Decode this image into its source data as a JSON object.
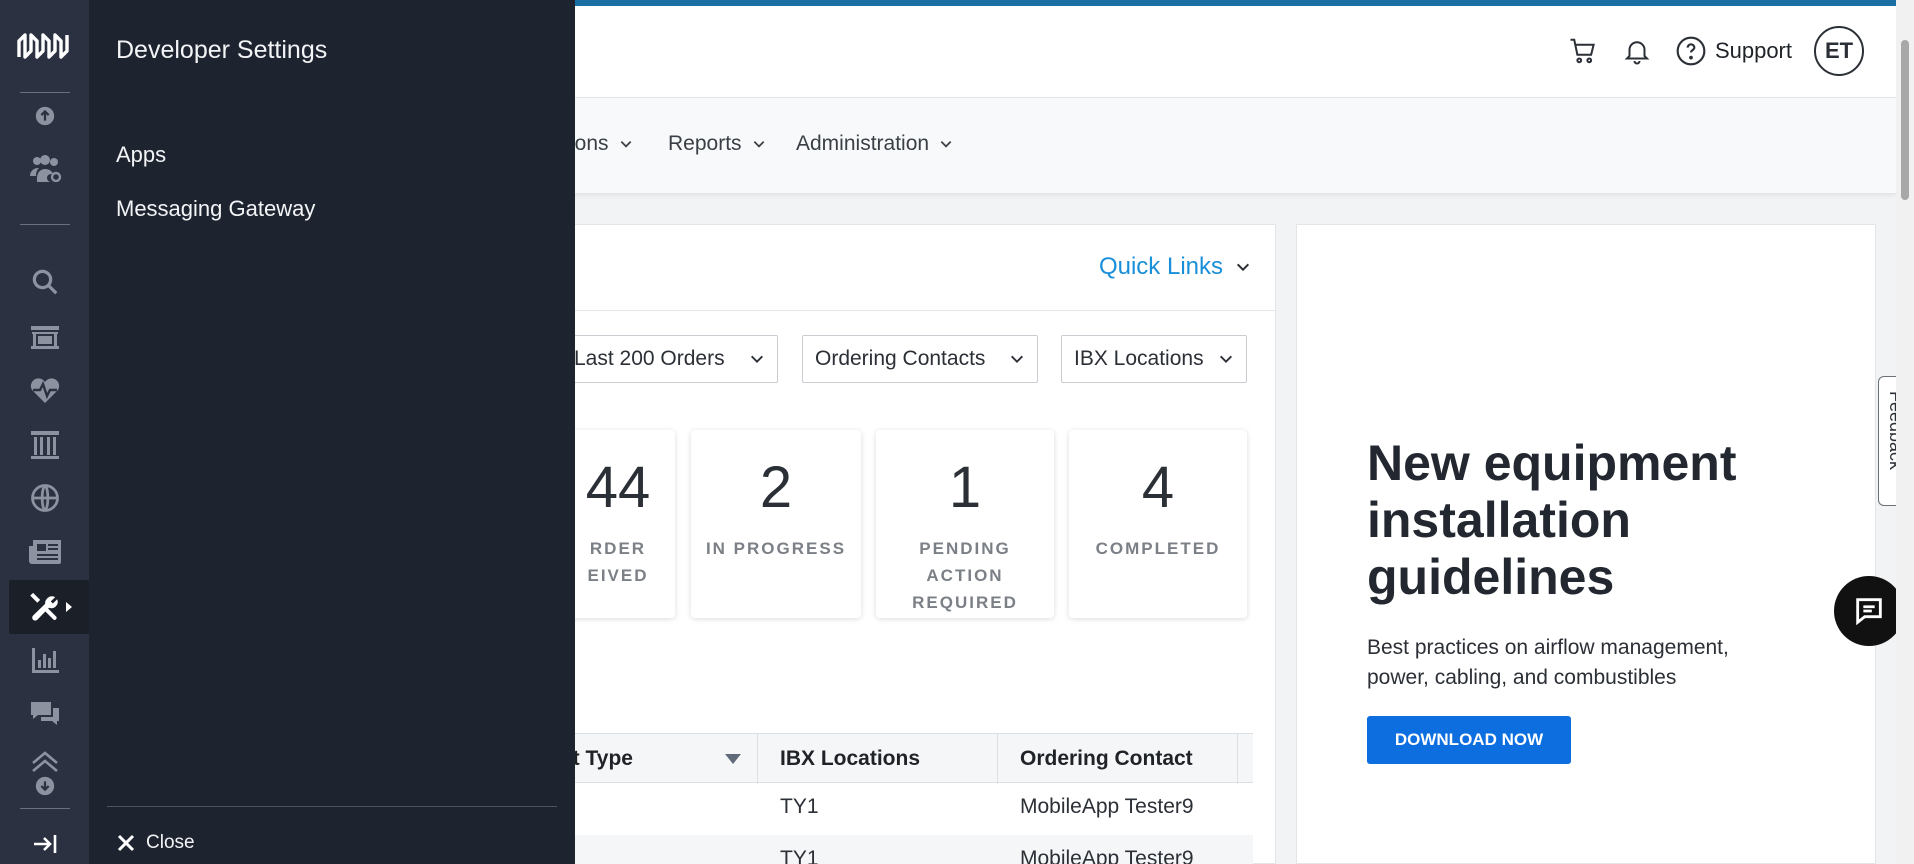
{
  "header": {
    "support_label": "Support",
    "avatar_initials": "ET"
  },
  "nav": {
    "items": [
      "ions",
      "Reports",
      "Administration"
    ]
  },
  "dashboard": {
    "quick_links": "Quick Links",
    "filters": [
      "Last 200 Orders",
      "Ordering Contacts",
      "IBX Locations"
    ],
    "stats": [
      {
        "value": "44",
        "label_lines": [
          "RDER",
          "EIVED"
        ]
      },
      {
        "value": "2",
        "label_lines": [
          "IN PROGRESS"
        ]
      },
      {
        "value": "1",
        "label_lines": [
          "PENDING",
          "ACTION",
          "REQUIRED"
        ]
      },
      {
        "value": "4",
        "label_lines": [
          "COMPLETED"
        ]
      }
    ],
    "table": {
      "columns": [
        "et Type",
        "IBX Locations",
        "Ordering Contact"
      ],
      "rows": [
        {
          "ibx": "TY1",
          "contact": "MobileApp Tester9"
        },
        {
          "ibx": "TY1",
          "contact": "MobileApp Tester9"
        }
      ]
    }
  },
  "promo": {
    "title": "New equipment installation guidelines",
    "subtitle": "Best practices on airflow management, power, cabling, and combustibles",
    "button": "DOWNLOAD NOW"
  },
  "feedback_label": "Feedback",
  "drawer": {
    "title": "Developer Settings",
    "links": [
      "Apps",
      "Messaging Gateway"
    ],
    "close_label": "Close"
  },
  "rail": {
    "icons": [
      "logo-icon",
      "upload-icon",
      "users-settings-icon",
      "search-icon",
      "store-icon",
      "health-icon",
      "columns-icon",
      "globe-icon",
      "news-icon",
      "tools-icon",
      "chart-icon",
      "chat-icon",
      "layers-icon",
      "download-icon",
      "logout-icon"
    ]
  },
  "colors": {
    "accent": "#0d6ee0",
    "link": "#1a8fd9",
    "rail": "#2b3140",
    "drawer": "#1e2330"
  }
}
